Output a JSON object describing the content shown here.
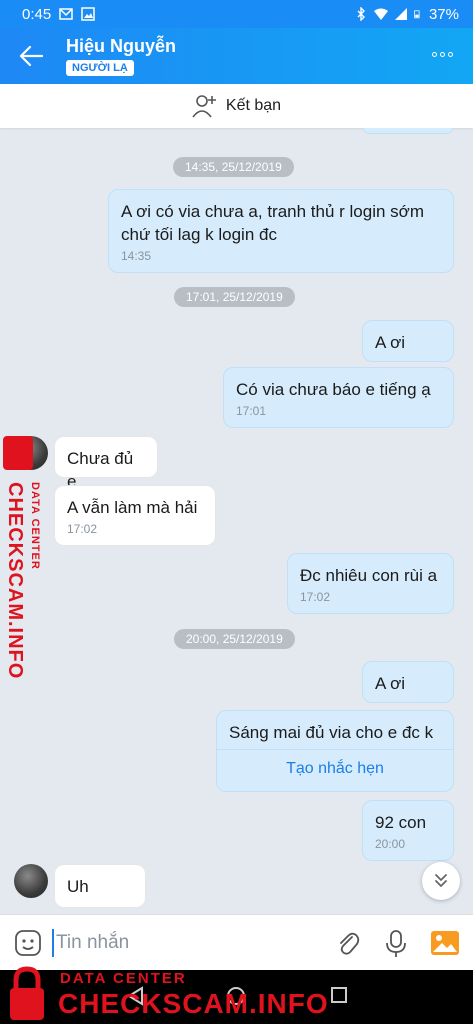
{
  "status_bar": {
    "time": "0:45",
    "battery": "37%"
  },
  "header": {
    "title": "Hiệu Nguyễn",
    "badge": "NGƯỜI LẠ"
  },
  "add_friend": {
    "label": "Kết bạn"
  },
  "messages": [
    {
      "type": "date",
      "text": "14:35, 25/12/2019"
    },
    {
      "type": "out",
      "text": "A ơi có via chưa a, tranh thủ r login sớm chứ tối lag k login đc",
      "time": "14:35"
    },
    {
      "type": "date",
      "text": "17:01, 25/12/2019"
    },
    {
      "type": "out",
      "text": "A ơi"
    },
    {
      "type": "out",
      "text": "Có via chưa báo e tiếng ạ",
      "time": "17:01"
    },
    {
      "type": "in",
      "text": "Chưa đủ e"
    },
    {
      "type": "in",
      "text": "A vẫn làm mà hải",
      "time": "17:02"
    },
    {
      "type": "out",
      "text": "Đc nhiêu con rùi a",
      "time": "17:02"
    },
    {
      "type": "date",
      "text": "20:00, 25/12/2019"
    },
    {
      "type": "out",
      "text": "A ơi"
    },
    {
      "type": "out",
      "text": "Sáng mai đủ via cho e đc k",
      "action": "Tạo nhắc hẹn"
    },
    {
      "type": "out",
      "text": "92 con",
      "time": "20:00"
    },
    {
      "type": "in",
      "text": "Uh"
    }
  ],
  "input": {
    "placeholder": "Tin nhắn"
  },
  "watermark": {
    "brand": "CHECKSCAM.INFO",
    "sub": "DATA CENTER"
  },
  "colors": {
    "header": "#1e88f5",
    "bubble_out": "#d6ecfc",
    "bubble_in": "#ffffff",
    "accent": "#1a7fe8",
    "watermark": "#e0121d"
  },
  "icons": [
    "back-arrow-icon",
    "more-options-icon",
    "add-friend-icon",
    "sticker-icon",
    "attachment-icon",
    "microphone-icon",
    "image-icon",
    "scroll-down-icon"
  ]
}
